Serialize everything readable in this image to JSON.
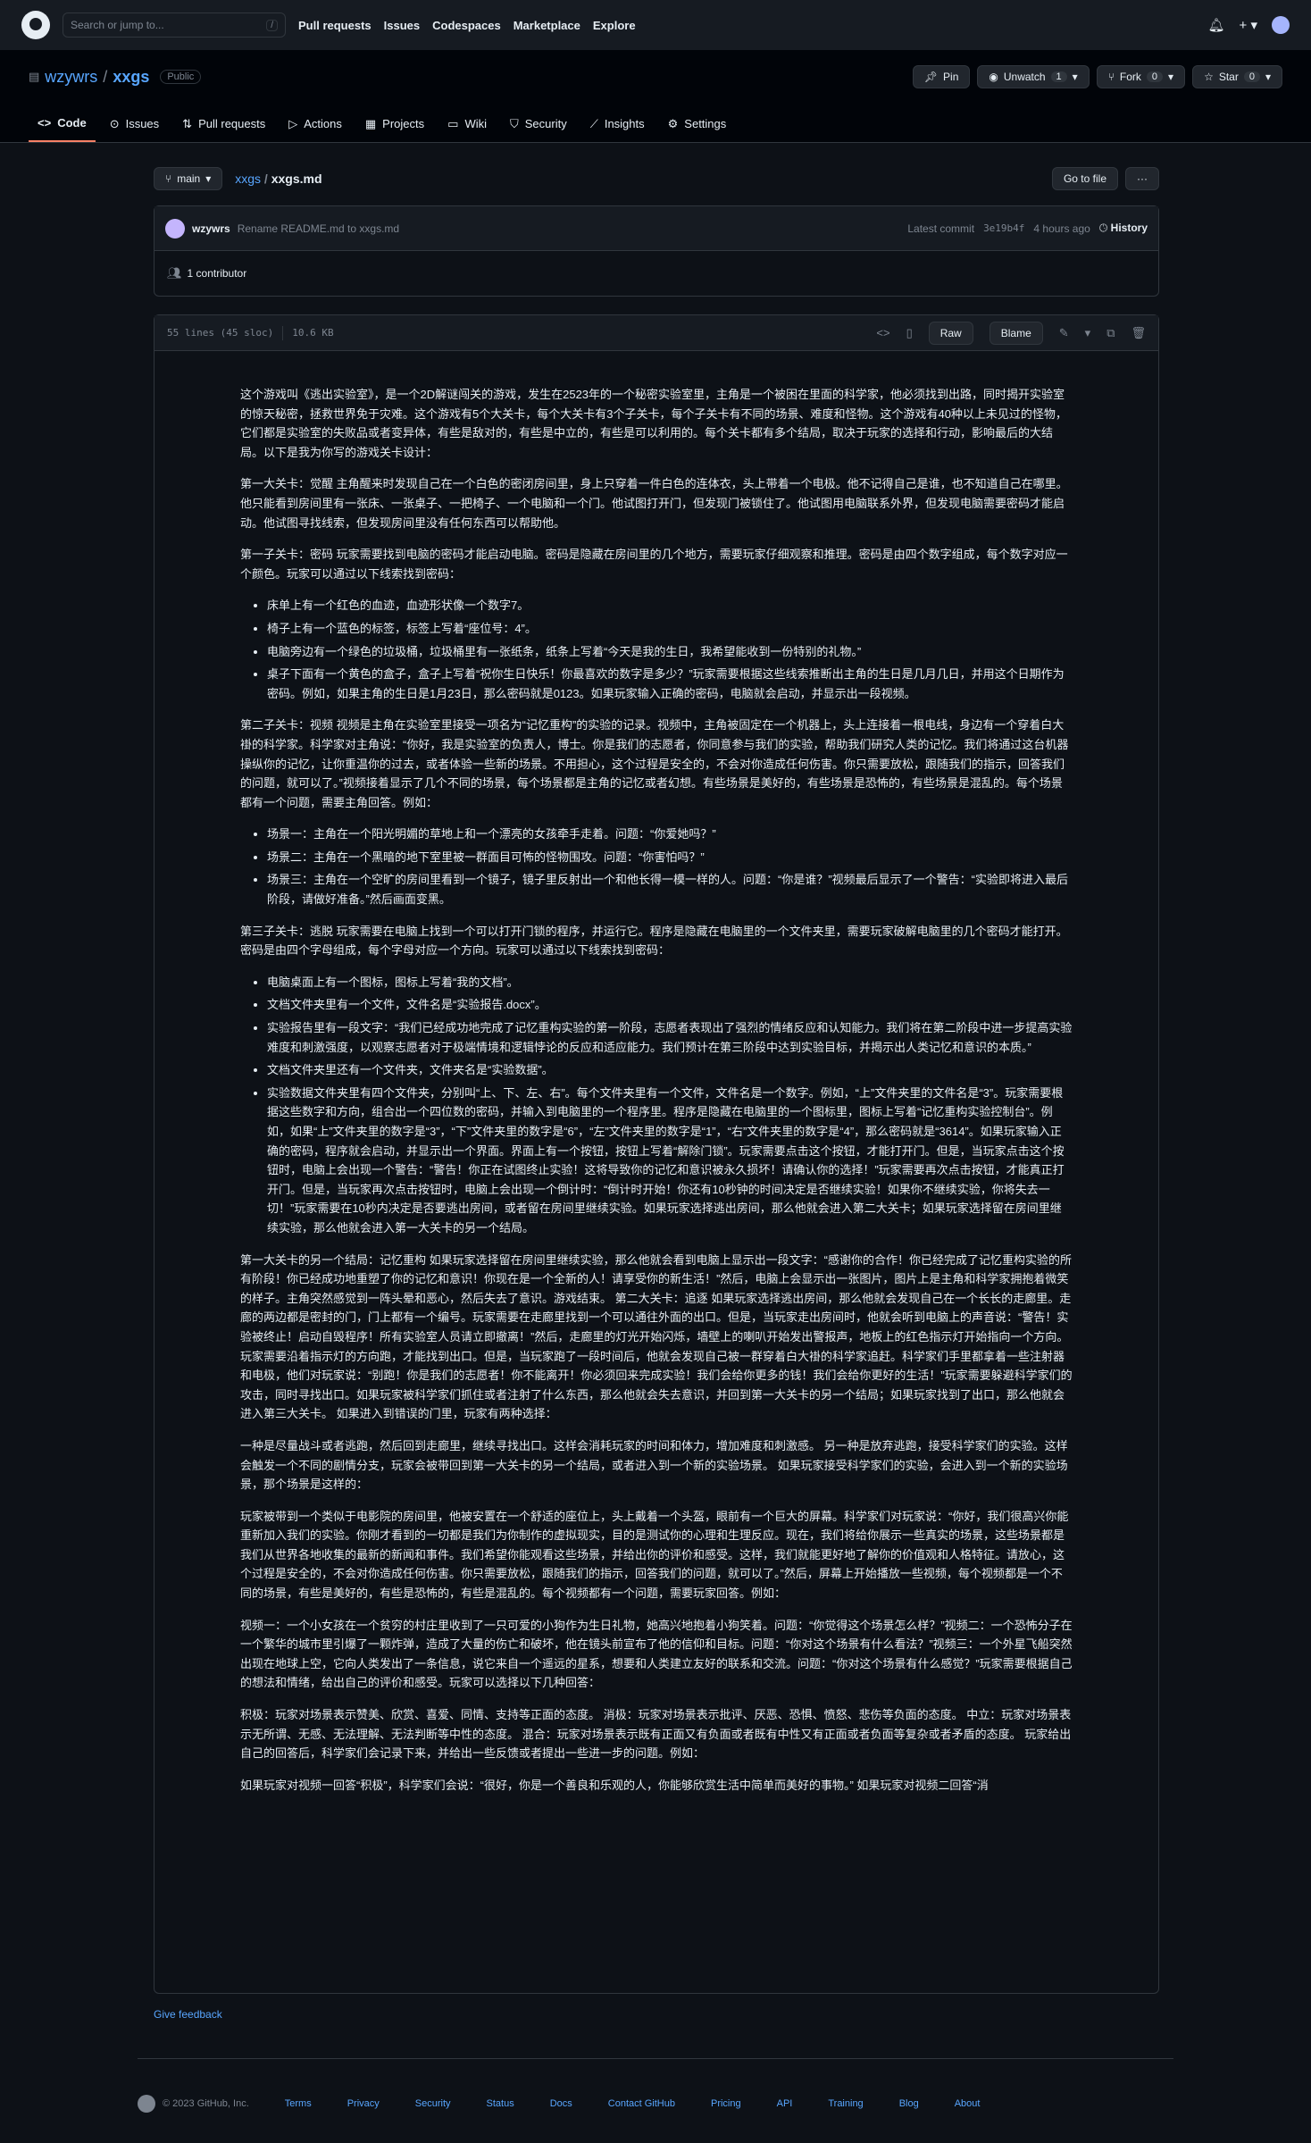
{
  "topbar": {
    "search_placeholder": "Search or jump to...",
    "search_key": "/",
    "nav": [
      "Pull requests",
      "Issues",
      "Codespaces",
      "Marketplace",
      "Explore"
    ]
  },
  "repo": {
    "owner": "wzywrs",
    "name": "xxgs",
    "visibility": "Public",
    "pin": "Pin",
    "watch": "Unwatch",
    "watch_count": "1",
    "fork": "Fork",
    "fork_count": "0",
    "star": "Star",
    "star_count": "0"
  },
  "tabs": [
    "Code",
    "Issues",
    "Pull requests",
    "Actions",
    "Projects",
    "Wiki",
    "Security",
    "Insights",
    "Settings"
  ],
  "file": {
    "branch": "main",
    "crumb_repo": "xxgs",
    "crumb_file": "xxgs.md",
    "goto": "Go to file",
    "more": "···",
    "commit_author": "wzywrs",
    "commit_message": "Rename README.md to xxgs.md",
    "latest_commit_label": "Latest commit",
    "commit_hash": "3e19b4f",
    "commit_time": "4 hours ago",
    "history": "History",
    "contributors": "1 contributor",
    "lines": "55 lines (45 sloc)",
    "size": "10.6 KB",
    "raw": "Raw",
    "blame": "Blame"
  },
  "content": {
    "p1": "这个游戏叫《逃出实验室》，是一个2D解谜闯关的游戏，发生在2523年的一个秘密实验室里，主角是一个被困在里面的科学家，他必须找到出路，同时揭开实验室的惊天秘密，拯救世界免于灾难。这个游戏有5个大关卡，每个大关卡有3个子关卡，每个子关卡有不同的场景、难度和怪物。这个游戏有40种以上未见过的怪物，它们都是实验室的失败品或者变异体，有些是敌对的，有些是中立的，有些是可以利用的。每个关卡都有多个结局，取决于玩家的选择和行动，影响最后的大结局。以下是我为你写的游戏关卡设计：",
    "p2": "第一大关卡：觉醒 主角醒来时发现自己在一个白色的密闭房间里，身上只穿着一件白色的连体衣，头上带着一个电极。他不记得自己是谁，也不知道自己在哪里。他只能看到房间里有一张床、一张桌子、一把椅子、一个电脑和一个门。他试图打开门，但发现门被锁住了。他试图用电脑联系外界，但发现电脑需要密码才能启动。他试图寻找线索，但发现房间里没有任何东西可以帮助他。",
    "p3": "第一子关卡：密码 玩家需要找到电脑的密码才能启动电脑。密码是隐藏在房间里的几个地方，需要玩家仔细观察和推理。密码是由四个数字组成，每个数字对应一个颜色。玩家可以通过以下线索找到密码：",
    "list1": [
      "床单上有一个红色的血迹，血迹形状像一个数字7。",
      "椅子上有一个蓝色的标签，标签上写着“座位号：4”。",
      "电脑旁边有一个绿色的垃圾桶，垃圾桶里有一张纸条，纸条上写着“今天是我的生日，我希望能收到一份特别的礼物。”",
      "桌子下面有一个黄色的盒子，盒子上写着“祝你生日快乐！你最喜欢的数字是多少？”玩家需要根据这些线索推断出主角的生日是几月几日，并用这个日期作为密码。例如，如果主角的生日是1月23日，那么密码就是0123。如果玩家输入正确的密码，电脑就会启动，并显示出一段视频。"
    ],
    "p4": "第二子关卡：视频 视频是主角在实验室里接受一项名为“记忆重构”的实验的记录。视频中，主角被固定在一个机器上，头上连接着一根电线，身边有一个穿着白大褂的科学家。科学家对主角说：“你好，我是实验室的负责人，博士。你是我们的志愿者，你同意参与我们的实验，帮助我们研究人类的记忆。我们将通过这台机器操纵你的记忆，让你重温你的过去，或者体验一些新的场景。不用担心，这个过程是安全的，不会对你造成任何伤害。你只需要放松，跟随我们的指示，回答我们的问题，就可以了。”视频接着显示了几个不同的场景，每个场景都是主角的记忆或者幻想。有些场景是美好的，有些场景是恐怖的，有些场景是混乱的。每个场景都有一个问题，需要主角回答。例如：",
    "list2": [
      "场景一：主角在一个阳光明媚的草地上和一个漂亮的女孩牵手走着。问题：“你爱她吗？”",
      "场景二：主角在一个黑暗的地下室里被一群面目可怖的怪物围攻。问题：“你害怕吗？”",
      "场景三：主角在一个空旷的房间里看到一个镜子，镜子里反射出一个和他长得一模一样的人。问题：“你是谁？”视频最后显示了一个警告：“实验即将进入最后阶段，请做好准备。”然后画面变黑。"
    ],
    "p5": "第三子关卡：逃脱 玩家需要在电脑上找到一个可以打开门锁的程序，并运行它。程序是隐藏在电脑里的一个文件夹里，需要玩家破解电脑里的几个密码才能打开。密码是由四个字母组成，每个字母对应一个方向。玩家可以通过以下线索找到密码：",
    "list3": [
      "电脑桌面上有一个图标，图标上写着“我的文档”。",
      "文档文件夹里有一个文件，文件名是“实验报告.docx”。",
      "实验报告里有一段文字：“我们已经成功地完成了记忆重构实验的第一阶段，志愿者表现出了强烈的情绪反应和认知能力。我们将在第二阶段中进一步提高实验难度和刺激强度，以观察志愿者对于极端情境和逻辑悖论的反应和适应能力。我们预计在第三阶段中达到实验目标，并揭示出人类记忆和意识的本质。”",
      "文档文件夹里还有一个文件夹，文件夹名是“实验数据”。",
      "实验数据文件夹里有四个文件夹，分别叫“上、下、左、右”。每个文件夹里有一个文件，文件名是一个数字。例如，“上”文件夹里的文件名是“3”。玩家需要根据这些数字和方向，组合出一个四位数的密码，并输入到电脑里的一个程序里。程序是隐藏在电脑里的一个图标里，图标上写着“记忆重构实验控制台”。例如，如果“上”文件夹里的数字是“3”，“下”文件夹里的数字是“6”，“左”文件夹里的数字是“1”，“右”文件夹里的数字是“4”，那么密码就是“3614”。如果玩家输入正确的密码，程序就会启动，并显示出一个界面。界面上有一个按钮，按钮上写着“解除门锁”。玩家需要点击这个按钮，才能打开门。但是，当玩家点击这个按钮时，电脑上会出现一个警告：“警告！你正在试图终止实验！这将导致你的记忆和意识被永久损坏！请确认你的选择！”玩家需要再次点击按钮，才能真正打开门。但是，当玩家再次点击按钮时，电脑上会出现一个倒计时：“倒计时开始！你还有10秒钟的时间决定是否继续实验！如果你不继续实验，你将失去一切！”玩家需要在10秒内决定是否要逃出房间，或者留在房间里继续实验。如果玩家选择逃出房间，那么他就会进入第二大关卡；如果玩家选择留在房间里继续实验，那么他就会进入第一大关卡的另一个结局。"
    ],
    "p6": "第一大关卡的另一个结局：记忆重构 如果玩家选择留在房间里继续实验，那么他就会看到电脑上显示出一段文字：“感谢你的合作！你已经完成了记忆重构实验的所有阶段！你已经成功地重塑了你的记忆和意识！你现在是一个全新的人！请享受你的新生活！”然后，电脑上会显示出一张图片，图片上是主角和科学家拥抱着微笑的样子。主角突然感觉到一阵头晕和恶心，然后失去了意识。游戏结束。 第二大关卡：追逐 如果玩家选择逃出房间，那么他就会发现自己在一个长长的走廊里。走廊的两边都是密封的门，门上都有一个编号。玩家需要在走廊里找到一个可以通往外面的出口。但是，当玩家走出房间时，他就会听到电脑上的声音说：“警告！实验被终止！启动自毁程序！所有实验室人员请立即撤离！”然后，走廊里的灯光开始闪烁，墙壁上的喇叭开始发出警报声，地板上的红色指示灯开始指向一个方向。玩家需要沿着指示灯的方向跑，才能找到出口。但是，当玩家跑了一段时间后，他就会发现自己被一群穿着白大褂的科学家追赶。科学家们手里都拿着一些注射器和电极，他们对玩家说：“别跑！你是我们的志愿者！你不能离开！你必须回来完成实验！我们会给你更多的钱！我们会给你更好的生活！”玩家需要躲避科学家们的攻击，同时寻找出口。如果玩家被科学家们抓住或者注射了什么东西，那么他就会失去意识，并回到第一大关卡的另一个结局；如果玩家找到了出口，那么他就会进入第三大关卡。 如果进入到错误的门里，玩家有两种选择：",
    "p7": "一种是尽量战斗或者逃跑，然后回到走廊里，继续寻找出口。这样会消耗玩家的时间和体力，增加难度和刺激感。 另一种是放弃逃跑，接受科学家们的实验。这样会触发一个不同的剧情分支，玩家会被带回到第一大关卡的另一个结局，或者进入到一个新的实验场景。 如果玩家接受科学家们的实验，会进入到一个新的实验场景，那个场景是这样的：",
    "p8": "玩家被带到一个类似于电影院的房间里，他被安置在一个舒适的座位上，头上戴着一个头盔，眼前有一个巨大的屏幕。科学家们对玩家说：“你好，我们很高兴你能重新加入我们的实验。你刚才看到的一切都是我们为你制作的虚拟现实，目的是测试你的心理和生理反应。现在，我们将给你展示一些真实的场景，这些场景都是我们从世界各地收集的最新的新闻和事件。我们希望你能观看这些场景，并给出你的评价和感受。这样，我们就能更好地了解你的价值观和人格特征。请放心，这个过程是安全的，不会对你造成任何伤害。你只需要放松，跟随我们的指示，回答我们的问题，就可以了。”然后，屏幕上开始播放一些视频，每个视频都是一个不同的场景，有些是美好的，有些是恐怖的，有些是混乱的。每个视频都有一个问题，需要玩家回答。例如：",
    "p9": "视频一：一个小女孩在一个贫穷的村庄里收到了一只可爱的小狗作为生日礼物，她高兴地抱着小狗笑着。问题：“你觉得这个场景怎么样？”视频二：一个恐怖分子在一个繁华的城市里引爆了一颗炸弹，造成了大量的伤亡和破坏，他在镜头前宣布了他的信仰和目标。问题：“你对这个场景有什么看法？”视频三：一个外星飞船突然出现在地球上空，它向人类发出了一条信息，说它来自一个遥远的星系，想要和人类建立友好的联系和交流。问题：“你对这个场景有什么感觉？”玩家需要根据自己的想法和情绪，给出自己的评价和感受。玩家可以选择以下几种回答：",
    "p10": "积极：玩家对场景表示赞美、欣赏、喜爱、同情、支持等正面的态度。 消极：玩家对场景表示批评、厌恶、恐惧、愤怒、悲伤等负面的态度。 中立：玩家对场景表示无所谓、无感、无法理解、无法判断等中性的态度。 混合：玩家对场景表示既有正面又有负面或者既有中性又有正面或者负面等复杂或者矛盾的态度。 玩家给出自己的回答后，科学家们会记录下来，并给出一些反馈或者提出一些进一步的问题。例如：",
    "p11": "如果玩家对视频一回答“积极”，科学家们会说：“很好，你是一个善良和乐观的人，你能够欣赏生活中简单而美好的事物。” 如果玩家对视频二回答“消"
  },
  "feedback": "Give feedback",
  "footer": {
    "copyright": "© 2023 GitHub, Inc.",
    "links": [
      "Terms",
      "Privacy",
      "Security",
      "Status",
      "Docs",
      "Contact GitHub",
      "Pricing",
      "API",
      "Training",
      "Blog",
      "About"
    ]
  }
}
